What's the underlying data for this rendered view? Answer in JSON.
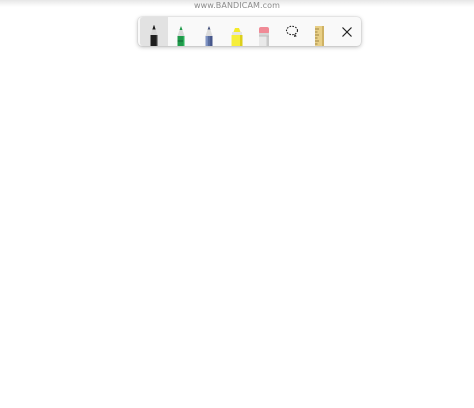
{
  "watermark": {
    "text": "www.BANDICAM.com"
  },
  "ink_toolbar": {
    "tools": [
      {
        "name": "ballpoint-pen",
        "icon": "ballpoint-pen-icon",
        "color": "#1a1a1a",
        "selected": true
      },
      {
        "name": "pen-green",
        "icon": "pen-icon",
        "color": "#1f9a4a",
        "selected": false
      },
      {
        "name": "pencil",
        "icon": "pencil-icon",
        "color": "#5a6ea0",
        "selected": false
      },
      {
        "name": "highlighter",
        "icon": "highlighter-icon",
        "color": "#f4ea2a",
        "selected": false
      },
      {
        "name": "eraser",
        "icon": "eraser-icon",
        "color": "#f08a96",
        "selected": false
      },
      {
        "name": "lasso-select",
        "icon": "lasso-select-icon",
        "selected": false
      },
      {
        "name": "ruler",
        "icon": "ruler-icon",
        "color": "#e8cf86",
        "selected": false
      },
      {
        "name": "close",
        "icon": "close-icon",
        "selected": false
      }
    ]
  }
}
